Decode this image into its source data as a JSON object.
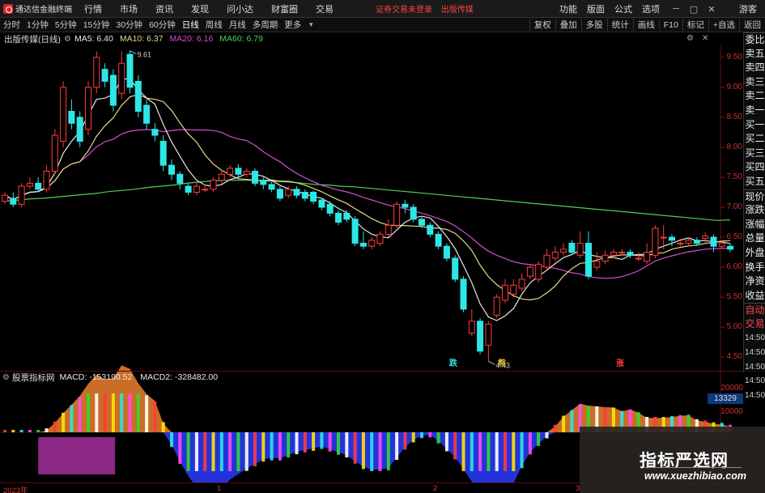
{
  "menubar": {
    "app_name": "通达信金融终端",
    "items": [
      "行情",
      "市场",
      "资讯",
      "发现",
      "问小达",
      "财富圈",
      "交易"
    ],
    "notice": [
      "证券交易未登录",
      "出版传媒"
    ],
    "right_items": [
      "功能",
      "版面",
      "公式",
      "选项"
    ],
    "guest": "游客"
  },
  "toolbar": {
    "periods": [
      "分时",
      "1分钟",
      "5分钟",
      "15分钟",
      "30分钟",
      "60分钟",
      "日线",
      "周线",
      "月线",
      "多周期",
      "更多"
    ],
    "active_period": "日线",
    "actions": [
      "复权",
      "叠加",
      "多股",
      "统计",
      "画线",
      "F10",
      "标记",
      "+自选",
      "返回"
    ]
  },
  "info": {
    "title": "出版传媒(日线)",
    "ma5": "MA5: 6.40",
    "ma10": "MA10: 6.37",
    "ma20": "MA20: 6.16",
    "ma60": "MA60: 6.79",
    "ctrl_icons": [
      "settings-icon",
      "close-icon"
    ]
  },
  "price_axis": [
    "9.50",
    "9.00",
    "8.50",
    "8.00",
    "7.50",
    "7.00",
    "6.50",
    "6.00",
    "5.50",
    "5.00",
    "4.50"
  ],
  "chart_annotations": {
    "high": "9.61",
    "low": "4.43",
    "markers": [
      {
        "text": "跌",
        "color": "#2ee6e6"
      },
      {
        "text": "熊",
        "color": "#e6c230"
      },
      {
        "text": "涨",
        "color": "#ff3b3b"
      }
    ]
  },
  "sidebar": {
    "items": [
      "委比",
      "卖五",
      "卖四",
      "卖三",
      "卖二",
      "卖一",
      "买一",
      "买二",
      "买三",
      "买四",
      "买五",
      "现价",
      "涨跌",
      "涨幅",
      "总量",
      "外盘",
      "换手",
      "净资",
      "收益"
    ],
    "auto_trade": [
      "自动",
      "交易"
    ],
    "times": [
      "14:50",
      "14:50",
      "14:50",
      "14:50",
      "14:50"
    ]
  },
  "indicator": {
    "name": "股票指标网",
    "macd": "MACD: -153190.52",
    "macd2": "MACD2: -328482.00",
    "axis": [
      "20000",
      "10000"
    ],
    "readout": "13329"
  },
  "date_axis": [
    "2023年",
    "1",
    "2",
    "3"
  ],
  "watermark": {
    "title": "指标严选网",
    "url": "www.xuezhibiao.com"
  },
  "chart_data": {
    "type": "candlestick",
    "title": "出版传媒(日线)",
    "y_range": [
      4.3,
      9.7
    ],
    "up_color": "#ff3b3b",
    "down_color": "#2ee6e6",
    "candles": [
      [
        7.1,
        7.2,
        7.05,
        7.25
      ],
      [
        7.15,
        7.05,
        7.0,
        7.25
      ],
      [
        7.05,
        7.35,
        7.0,
        7.4
      ],
      [
        7.35,
        7.4,
        7.3,
        7.5
      ],
      [
        7.4,
        7.3,
        7.25,
        7.5
      ],
      [
        7.3,
        7.6,
        7.25,
        7.7
      ],
      [
        7.6,
        8.2,
        7.55,
        8.3
      ],
      [
        8.1,
        9.0,
        8.0,
        9.1
      ],
      [
        8.6,
        8.4,
        8.3,
        8.8
      ],
      [
        8.5,
        8.1,
        8.0,
        8.6
      ],
      [
        8.3,
        9.0,
        8.2,
        9.1
      ],
      [
        9.0,
        9.5,
        8.9,
        9.6
      ],
      [
        9.3,
        9.1,
        9.0,
        9.4
      ],
      [
        9.2,
        8.7,
        8.6,
        9.3
      ],
      [
        8.9,
        9.4,
        8.8,
        9.6
      ],
      [
        9.55,
        9.0,
        8.9,
        9.61
      ],
      [
        9.1,
        8.6,
        8.5,
        9.2
      ],
      [
        8.7,
        8.4,
        8.3,
        8.8
      ],
      [
        8.3,
        8.2,
        8.1,
        8.4
      ],
      [
        8.1,
        7.7,
        7.6,
        8.2
      ],
      [
        7.7,
        7.55,
        7.45,
        7.8
      ],
      [
        7.55,
        7.4,
        7.3,
        7.6
      ],
      [
        7.35,
        7.25,
        7.2,
        7.4
      ],
      [
        7.25,
        7.35,
        7.2,
        7.4
      ],
      [
        7.3,
        7.3,
        7.25,
        7.38
      ],
      [
        7.3,
        7.45,
        7.25,
        7.5
      ],
      [
        7.45,
        7.55,
        7.4,
        7.62
      ],
      [
        7.55,
        7.65,
        7.5,
        7.7
      ],
      [
        7.65,
        7.55,
        7.5,
        7.72
      ],
      [
        7.55,
        7.6,
        7.5,
        7.65
      ],
      [
        7.6,
        7.4,
        7.35,
        7.65
      ],
      [
        7.45,
        7.38,
        7.3,
        7.5
      ],
      [
        7.38,
        7.3,
        7.25,
        7.42
      ],
      [
        7.3,
        7.15,
        7.1,
        7.35
      ],
      [
        7.2,
        7.3,
        7.15,
        7.35
      ],
      [
        7.3,
        7.2,
        7.15,
        7.35
      ],
      [
        7.25,
        7.15,
        7.1,
        7.3
      ],
      [
        7.25,
        7.1,
        7.05,
        7.28
      ],
      [
        7.12,
        7.0,
        6.95,
        7.15
      ],
      [
        7.05,
        6.9,
        6.85,
        7.1
      ],
      [
        6.9,
        6.75,
        6.7,
        6.95
      ],
      [
        6.9,
        6.8,
        6.75,
        6.95
      ],
      [
        6.8,
        6.4,
        6.35,
        6.85
      ],
      [
        6.4,
        6.35,
        6.3,
        6.6
      ],
      [
        6.35,
        6.45,
        6.3,
        6.5
      ],
      [
        6.4,
        6.55,
        6.35,
        6.6
      ],
      [
        6.55,
        6.7,
        6.5,
        6.8
      ],
      [
        6.7,
        7.05,
        6.65,
        7.1
      ],
      [
        7.05,
        7.0,
        6.9,
        7.12
      ],
      [
        7.0,
        6.8,
        6.75,
        7.05
      ],
      [
        6.8,
        6.7,
        6.65,
        6.85
      ],
      [
        6.7,
        6.55,
        6.5,
        6.75
      ],
      [
        6.55,
        6.35,
        6.3,
        6.6
      ],
      [
        6.35,
        6.15,
        6.1,
        6.4
      ],
      [
        6.15,
        5.8,
        5.75,
        6.2
      ],
      [
        5.8,
        5.3,
        5.25,
        5.85
      ],
      [
        4.9,
        5.1,
        4.85,
        5.3
      ],
      [
        5.1,
        4.6,
        4.55,
        5.15
      ],
      [
        4.7,
        5.05,
        4.43,
        5.1
      ],
      [
        5.2,
        5.5,
        5.15,
        5.55
      ],
      [
        5.45,
        5.7,
        5.4,
        5.8
      ],
      [
        5.55,
        5.7,
        5.5,
        5.8
      ],
      [
        5.65,
        5.8,
        5.6,
        5.9
      ],
      [
        5.85,
        6.0,
        5.8,
        6.05
      ],
      [
        5.8,
        6.05,
        5.75,
        6.1
      ],
      [
        6.0,
        6.2,
        5.95,
        6.3
      ],
      [
        6.15,
        6.25,
        6.1,
        6.35
      ],
      [
        6.25,
        6.3,
        6.2,
        6.4
      ],
      [
        6.4,
        6.25,
        6.2,
        6.45
      ],
      [
        6.2,
        6.4,
        6.15,
        6.6
      ],
      [
        6.4,
        5.85,
        5.8,
        6.6
      ],
      [
        6.0,
        6.1,
        5.95,
        6.25
      ],
      [
        6.1,
        6.2,
        6.05,
        6.28
      ],
      [
        6.2,
        6.25,
        6.15,
        6.3
      ],
      [
        6.25,
        6.25,
        6.2,
        6.3
      ],
      [
        6.25,
        6.2,
        6.15,
        6.3
      ],
      [
        6.15,
        6.15,
        6.1,
        6.25
      ],
      [
        6.1,
        6.25,
        6.05,
        6.4
      ],
      [
        6.2,
        6.65,
        6.15,
        6.7
      ],
      [
        6.5,
        6.5,
        6.3,
        6.7
      ],
      [
        6.5,
        6.45,
        6.35,
        6.55
      ],
      [
        6.4,
        6.4,
        6.35,
        6.48
      ],
      [
        6.4,
        6.45,
        6.35,
        6.5
      ],
      [
        6.45,
        6.4,
        6.35,
        6.5
      ],
      [
        6.48,
        6.52,
        6.4,
        6.58
      ],
      [
        6.5,
        6.35,
        6.25,
        6.55
      ],
      [
        6.35,
        6.4,
        6.3,
        6.45
      ],
      [
        6.35,
        6.3,
        6.25,
        6.4
      ]
    ],
    "ma60": [
      7.1,
      7.12,
      7.14,
      7.15,
      7.17,
      7.19,
      7.21,
      7.23,
      7.26,
      7.28,
      7.3,
      7.33,
      7.35,
      7.37,
      7.4,
      7.42,
      7.44,
      7.45,
      7.45,
      7.45,
      7.44,
      7.43,
      7.42,
      7.4,
      7.38,
      7.37,
      7.35,
      7.34,
      7.32,
      7.3,
      7.28,
      7.26,
      7.24,
      7.22,
      7.2,
      7.18,
      7.16,
      7.14,
      7.12,
      7.1,
      7.08,
      7.06,
      7.04,
      7.02,
      7.0,
      6.98,
      6.96,
      6.94,
      6.92,
      6.9,
      6.88,
      6.86,
      6.84,
      6.82,
      6.8,
      6.78,
      6.79
    ],
    "indicator_type": "MACD histogram",
    "macd": -153190.52,
    "macd2": -328482.0
  }
}
